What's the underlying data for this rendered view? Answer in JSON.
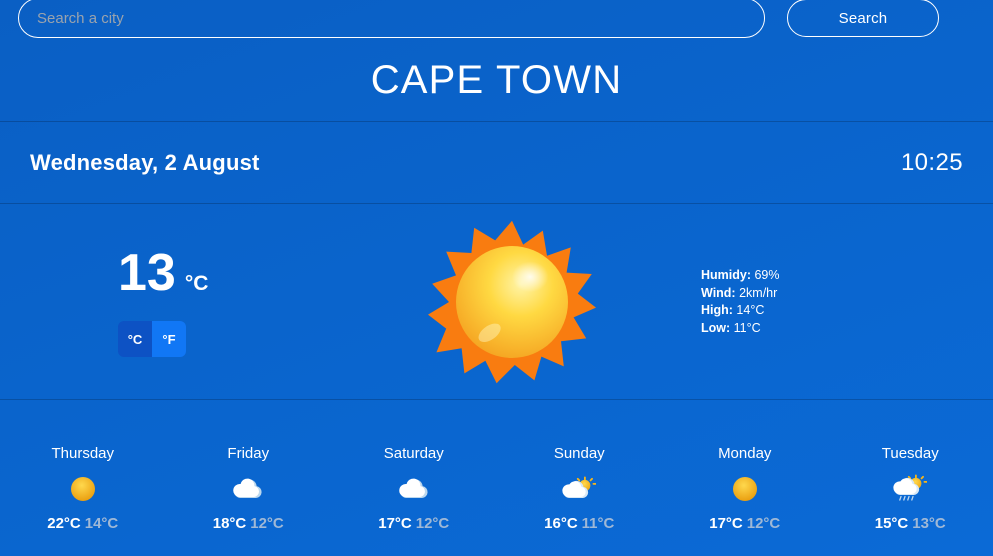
{
  "search": {
    "placeholder": "Search a city",
    "value": "",
    "button_label": "Search"
  },
  "location": {
    "city": "CAPE TOWN"
  },
  "datetime": {
    "date": "Wednesday, 2 August",
    "time": "10:25"
  },
  "current": {
    "temperature": "13",
    "unit": "°C",
    "icon": "sun-icon",
    "unit_toggle": {
      "celsius_label": "°C",
      "fahrenheit_label": "°F",
      "selected": "°C"
    },
    "stats": [
      {
        "label": "Humidy:",
        "value": "69%"
      },
      {
        "label": "Wind:",
        "value": "2km/hr"
      },
      {
        "label": "High:",
        "value": "14°C"
      },
      {
        "label": "Low:",
        "value": "11°C"
      }
    ]
  },
  "forecast": [
    {
      "day": "Thursday",
      "icon": "sun-icon",
      "high": "22°C",
      "low": "14°C"
    },
    {
      "day": "Friday",
      "icon": "cloud-icon",
      "high": "18°C",
      "low": "12°C"
    },
    {
      "day": "Saturday",
      "icon": "cloud-icon",
      "high": "17°C",
      "low": "12°C"
    },
    {
      "day": "Sunday",
      "icon": "sun-behind-cloud-icon",
      "high": "16°C",
      "low": "11°C"
    },
    {
      "day": "Monday",
      "icon": "sun-icon",
      "high": "17°C",
      "low": "12°C"
    },
    {
      "day": "Tuesday",
      "icon": "sun-behind-rain-icon",
      "high": "15°C",
      "low": "13°C"
    }
  ],
  "colors": {
    "background": "#0a64cc",
    "accent": "#1177f5",
    "toggle_inactive": "#0d52c4",
    "sun": "#f0a500",
    "cloud": "#ffffff",
    "low_temp": "#9fb8d6"
  }
}
